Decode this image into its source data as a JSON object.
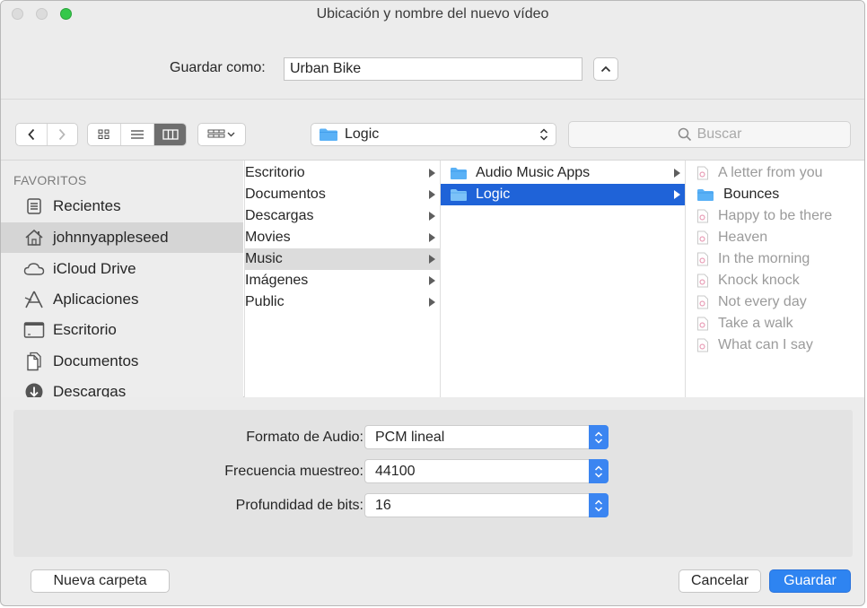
{
  "window": {
    "title": "Ubicación y nombre del nuevo vídeo"
  },
  "save_as": {
    "label": "Guardar como:",
    "value": "Urban Bike"
  },
  "path_popup": {
    "label": "Logic"
  },
  "search": {
    "placeholder": "Buscar"
  },
  "sidebar": {
    "header": "FAVORITOS",
    "items": [
      {
        "label": "Recientes",
        "icon": "recents-icon"
      },
      {
        "label": "johnnyappleseed",
        "icon": "home-icon",
        "selected": true
      },
      {
        "label": "iCloud Drive",
        "icon": "cloud-icon"
      },
      {
        "label": "Aplicaciones",
        "icon": "applications-icon"
      },
      {
        "label": "Escritorio",
        "icon": "desktop-icon"
      },
      {
        "label": "Documentos",
        "icon": "documents-icon"
      },
      {
        "label": "Descargas",
        "icon": "downloads-icon"
      }
    ]
  },
  "column1": {
    "items": [
      {
        "label": "Escritorio"
      },
      {
        "label": "Documentos"
      },
      {
        "label": "Descargas"
      },
      {
        "label": "Movies"
      },
      {
        "label": "Music",
        "selected": true
      },
      {
        "label": "Imágenes"
      },
      {
        "label": "Public"
      }
    ]
  },
  "column2": {
    "items": [
      {
        "label": "Audio Music Apps"
      },
      {
        "label": "Logic",
        "selected": true
      }
    ]
  },
  "column3": {
    "items": [
      {
        "label": "A letter from you",
        "type": "file"
      },
      {
        "label": "Bounces",
        "type": "folder"
      },
      {
        "label": "Happy to be there",
        "type": "file"
      },
      {
        "label": "Heaven",
        "type": "file"
      },
      {
        "label": "In the morning",
        "type": "file"
      },
      {
        "label": "Knock knock",
        "type": "file"
      },
      {
        "label": "Not every day",
        "type": "file"
      },
      {
        "label": "Take a walk",
        "type": "file"
      },
      {
        "label": "What can I say",
        "type": "file"
      }
    ]
  },
  "options": {
    "audio_format": {
      "label": "Formato de Audio:",
      "value": "PCM lineal"
    },
    "sample_rate": {
      "label": "Frecuencia muestreo:",
      "value": "44100"
    },
    "bit_depth": {
      "label": "Profundidad de bits:",
      "value": "16"
    }
  },
  "buttons": {
    "new_folder": "Nueva carpeta",
    "cancel": "Cancelar",
    "save": "Guardar"
  },
  "colors": {
    "accent": "#2e84f1",
    "selection_blue": "#1f63d8",
    "folder_blue": "#5ab1f6",
    "zoom_green": "#34c84a"
  }
}
